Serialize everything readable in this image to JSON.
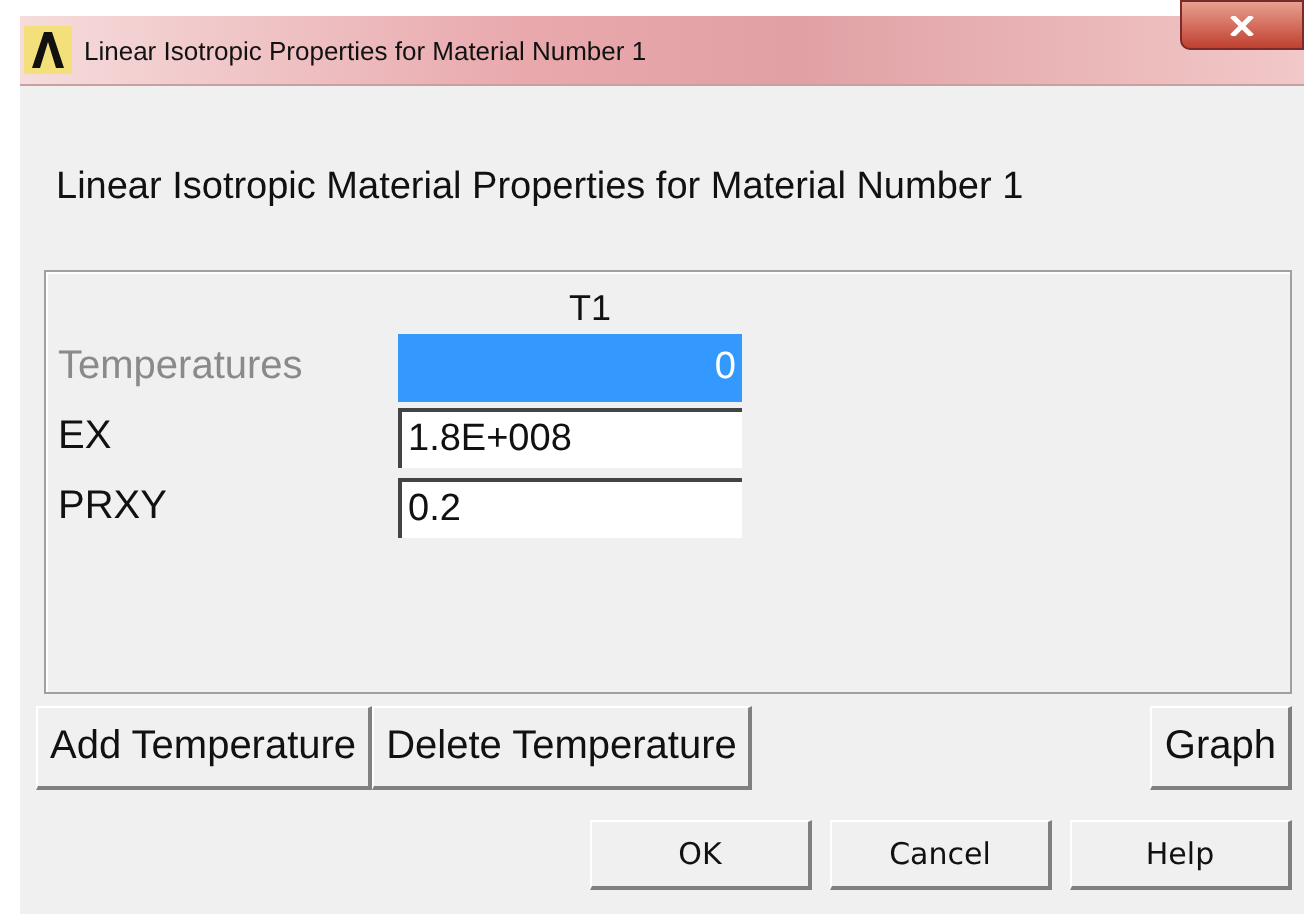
{
  "window": {
    "title": "Linear Isotropic Properties for Material Number 1"
  },
  "heading": "Linear Isotropic Material Properties for Material Number 1",
  "table": {
    "columns": [
      "T1"
    ],
    "rows": [
      {
        "label": "Temperatures",
        "value": "0",
        "disabled": true,
        "selected": true
      },
      {
        "label": "EX",
        "value": "1.8E+008",
        "disabled": false,
        "selected": false
      },
      {
        "label": "PRXY",
        "value": "0.2",
        "disabled": false,
        "selected": false
      }
    ]
  },
  "table_buttons": [
    "Add Temperature",
    "Delete Temperature",
    "Graph"
  ],
  "dialog_buttons": [
    "OK",
    "Cancel",
    "Help"
  ]
}
